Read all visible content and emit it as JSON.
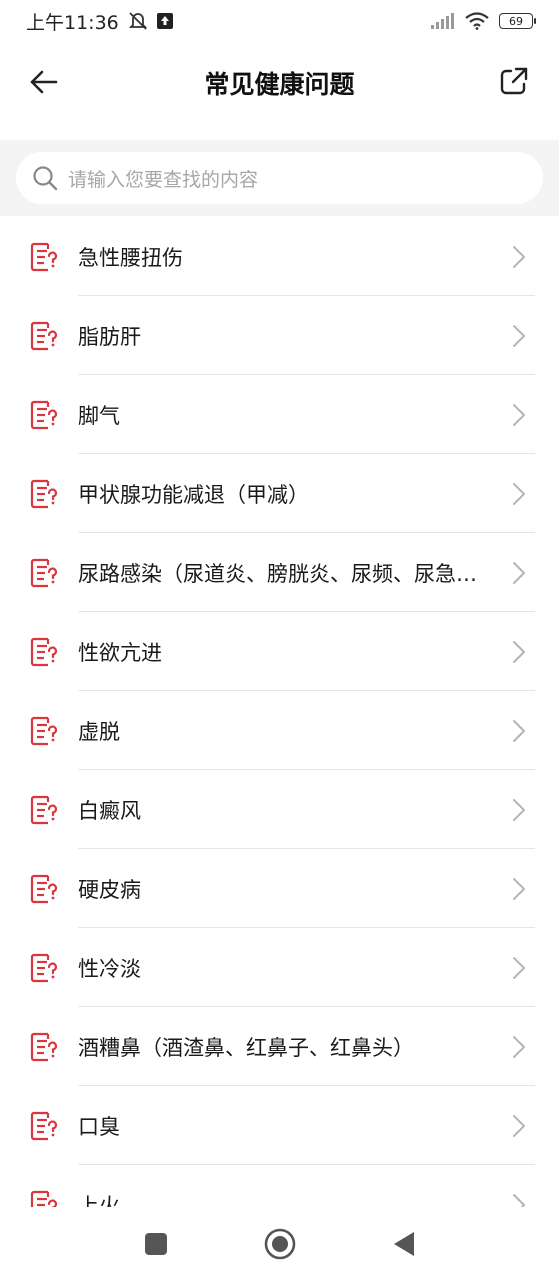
{
  "status_bar": {
    "time": "上午11:36",
    "battery": "69"
  },
  "header": {
    "title": "常见健康问题"
  },
  "search": {
    "placeholder": "请输入您要查找的内容"
  },
  "list": {
    "items": [
      {
        "label": "急性腰扭伤"
      },
      {
        "label": "脂肪肝"
      },
      {
        "label": "脚气"
      },
      {
        "label": "甲状腺功能减退（甲减）"
      },
      {
        "label": "尿路感染（尿道炎、膀胱炎、尿频、尿急、尿痛）"
      },
      {
        "label": "性欲亢进"
      },
      {
        "label": "虚脱"
      },
      {
        "label": "白癜风"
      },
      {
        "label": "硬皮病"
      },
      {
        "label": "性冷淡"
      },
      {
        "label": "酒糟鼻（酒渣鼻、红鼻子、红鼻头）"
      },
      {
        "label": "口臭"
      },
      {
        "label": "上火"
      }
    ]
  },
  "colors": {
    "accent": "#d9363e",
    "divider": "#e6e6e6",
    "chevron": "#b5b5b5"
  }
}
